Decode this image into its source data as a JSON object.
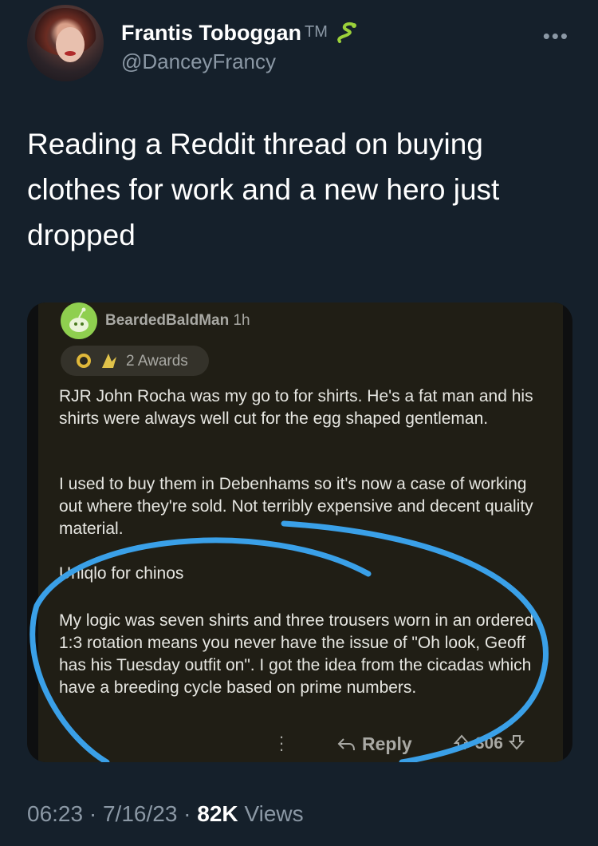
{
  "tweet": {
    "display_name": "Frantis Toboggan",
    "tm": "TM",
    "handle": "@DanceyFrancy",
    "text": "Reading a Reddit thread on buying clothes for work and a new hero just dropped",
    "more_icon": "more-icon",
    "emoji_icon": "snake-icon"
  },
  "reddit": {
    "username": "BeardedBaldMan",
    "age": "1h",
    "awards_label": "2 Awards",
    "paragraphs": [
      "RJR John Rocha was my go to for shirts. He's a fat man and his shirts were always well cut for the egg shaped gentleman.",
      "I used to buy them in Debenhams so it's now a case of working out where they're sold. Not terribly expensive and decent quality material.",
      "Uniqlo for chinos",
      "My logic was seven shirts and three trousers worn in an ordered 1:3 rotation means you never have the issue of \"Oh look, Geoff has his Tuesday outfit on\". I got the idea from the cicadas which have a breeding cycle based on prime numbers."
    ],
    "reply_label": "Reply",
    "score": "306",
    "annotation_color": "#3aa0e8"
  },
  "meta": {
    "time": "06:23",
    "date": "7/16/23",
    "views_count": "82K",
    "views_label": "Views"
  }
}
